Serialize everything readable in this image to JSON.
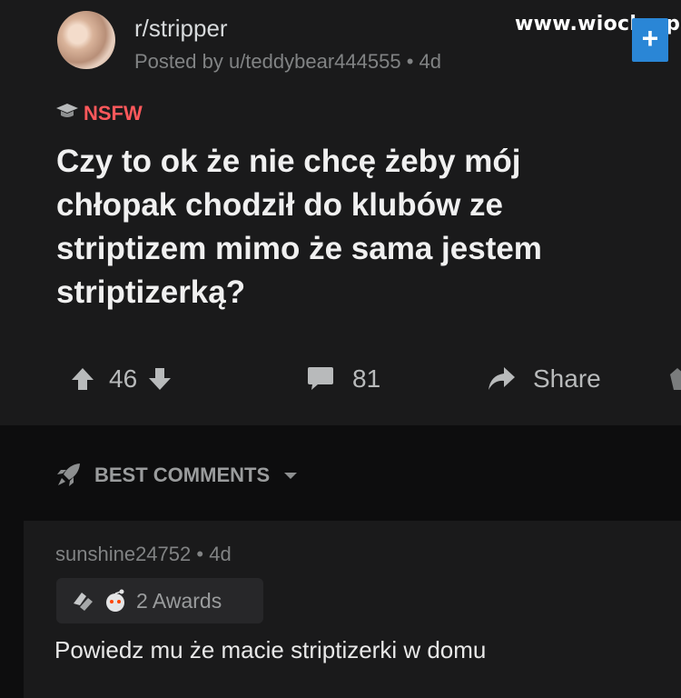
{
  "post": {
    "subreddit": "r/stripper",
    "posted_by": "Posted by u/teddybear444555",
    "age": "4d",
    "flair": "NSFW",
    "title": "Czy to ok że nie chcę żeby mój chłopak chodził do klubów ze striptizem mimo że sama jestem striptizerką?"
  },
  "watermark": {
    "text": "www.wiocha.pl",
    "plus": "+"
  },
  "actions": {
    "votes": "46",
    "comments": "81",
    "share": "Share"
  },
  "sort": {
    "label": "BEST COMMENTS"
  },
  "comment": {
    "author": "sunshine24752",
    "age": "4d",
    "awards": "2 Awards",
    "body": "Powiedz mu że macie striptizerki w domu"
  },
  "colors": {
    "background": "#0d0d0e",
    "card": "#1a1a1b",
    "nsfw": "#ff585b",
    "watermark_badge": "#2a86d6"
  }
}
